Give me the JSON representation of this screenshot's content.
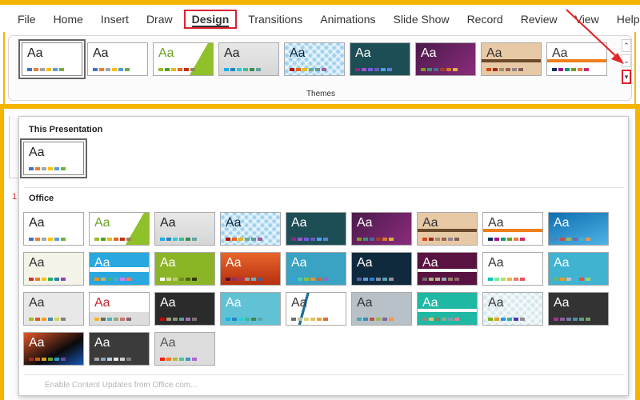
{
  "menu": {
    "items": [
      "File",
      "Home",
      "Insert",
      "Draw",
      "Design",
      "Transitions",
      "Animations",
      "Slide Show",
      "Record",
      "Review",
      "View",
      "Help"
    ],
    "active_index": 4
  },
  "ribbon": {
    "group_label": "Themes",
    "thumb_text": "Aa",
    "scroll_up_icon": "chevron-up-icon",
    "scroll_down_icon": "chevron-down-icon",
    "more_icon": "gallery-more-icon"
  },
  "gallery": {
    "this_presentation_label": "This Presentation",
    "office_label": "Office",
    "footer": "Enable Content Updates from Office.com...",
    "thumb_text": "Aa"
  },
  "colors": {
    "highlight_border": "#f4b400",
    "red_box": "#d9232f"
  }
}
